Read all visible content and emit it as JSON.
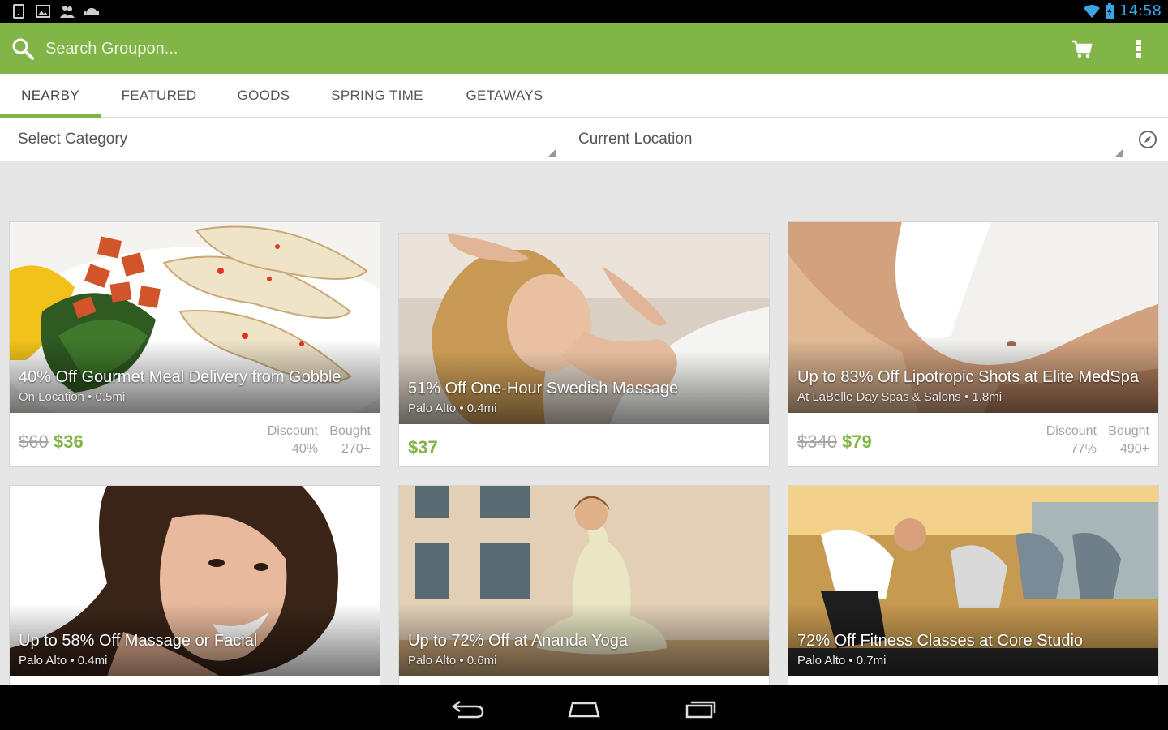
{
  "status_bar": {
    "time": "14:58",
    "left_icons": [
      "tablet-icon",
      "image-icon",
      "people-icon",
      "android-icon"
    ],
    "right_icons": [
      "wifi-icon",
      "battery-icon"
    ]
  },
  "action_bar": {
    "search_placeholder": "Search Groupon...",
    "icons": [
      "search-icon",
      "cart-icon",
      "overflow-menu-icon"
    ],
    "color": "#82b548"
  },
  "tabs": [
    {
      "label": "NEARBY",
      "active": true
    },
    {
      "label": "FEATURED",
      "active": false
    },
    {
      "label": "GOODS",
      "active": false
    },
    {
      "label": "SPRING TIME",
      "active": false
    },
    {
      "label": "GETAWAYS",
      "active": false
    }
  ],
  "filters": {
    "category": "Select Category",
    "location": "Current Location",
    "location_icon": "compass-icon"
  },
  "deals": [
    {
      "title": "40% Off Gourmet Meal Delivery from Gobble",
      "subtitle": "On Location • 0.5mi",
      "old_price": "$60",
      "price": "$36",
      "discount_label": "Discount",
      "discount": "40%",
      "bought_label": "Bought",
      "bought": "270+"
    },
    {
      "title": "51% Off One-Hour Swedish Massage",
      "subtitle": "Palo Alto • 0.4mi",
      "price": "$37"
    },
    {
      "title": "Up to 83% Off Lipotropic Shots at Elite MedSpa",
      "subtitle": "At LaBelle Day Spas & Salons • 1.8mi",
      "old_price": "$340",
      "price": "$79",
      "discount_label": "Discount",
      "discount": "77%",
      "bought_label": "Bought",
      "bought": "490+"
    },
    {
      "title": "Up to 58% Off Massage or Facial",
      "subtitle": "Palo Alto • 0.4mi"
    },
    {
      "title": "Up to 72% Off at Ananda Yoga",
      "subtitle": "Palo Alto • 0.6mi"
    },
    {
      "title": "72% Off Fitness Classes at Core Studio",
      "subtitle": "Palo Alto • 0.7mi"
    }
  ],
  "nav_bar": {
    "icons": [
      "back-icon",
      "home-icon",
      "recent-apps-icon"
    ]
  }
}
